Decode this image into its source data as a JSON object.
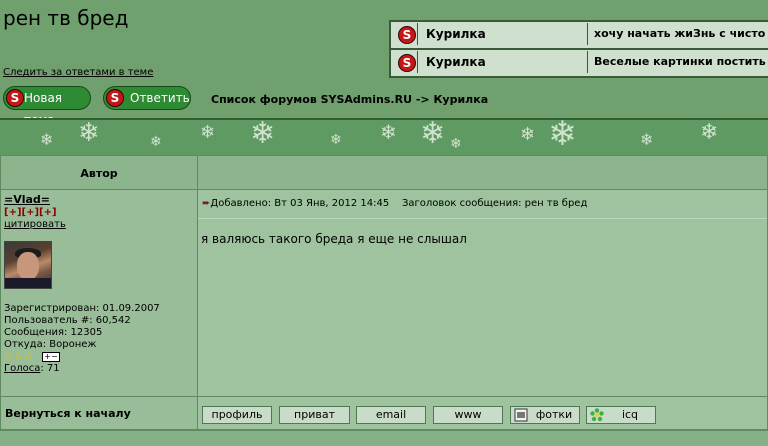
{
  "topic": {
    "title": "рен тв бред",
    "follow_link": "Следить за ответами в теме"
  },
  "related_topics": [
    {
      "badge": "S",
      "forum": "Курилка",
      "subject": "хочу начать жиЗнь с чисто"
    },
    {
      "badge": "S",
      "forum": "Курилка",
      "subject": "Веселые картинки постить"
    }
  ],
  "toolbar": {
    "new_topic_label": "Новая тема",
    "reply_label": "Ответить",
    "badge": "S",
    "nav_path": "Список форумов SYSAdmins.RU -> Курилка"
  },
  "table": {
    "author_header": "Автор",
    "back_to_top": "Вернуться к началу"
  },
  "author": {
    "name": "=Vlad=",
    "reputation": "[+][+][+]",
    "quote_link": "цитировать",
    "registered": "Зарегистрирован: 01.09.2007",
    "user_no": "Пользователь #: 60,542",
    "messages": "Сообщения: 12305",
    "location": "Откуда: Воронеж",
    "rank_stars": "☆☆☆",
    "votes_label": "Голоса",
    "votes_value": ": 71"
  },
  "post": {
    "added": "Добавлено: Вт 03 Янв, 2012 14:45",
    "subject": "Заголовок сообщения: рен тв бред",
    "body": "я валяюсь такого бреда я еще не слышал"
  },
  "post_buttons": {
    "profile": "профиль",
    "pm": "приват",
    "email": "email",
    "www": "www",
    "photos": "фотки",
    "icq": "icq"
  },
  "colors": {
    "header_green": "#6fa06e",
    "badge_red": "#c41818",
    "button_green": "#2f8a34"
  }
}
